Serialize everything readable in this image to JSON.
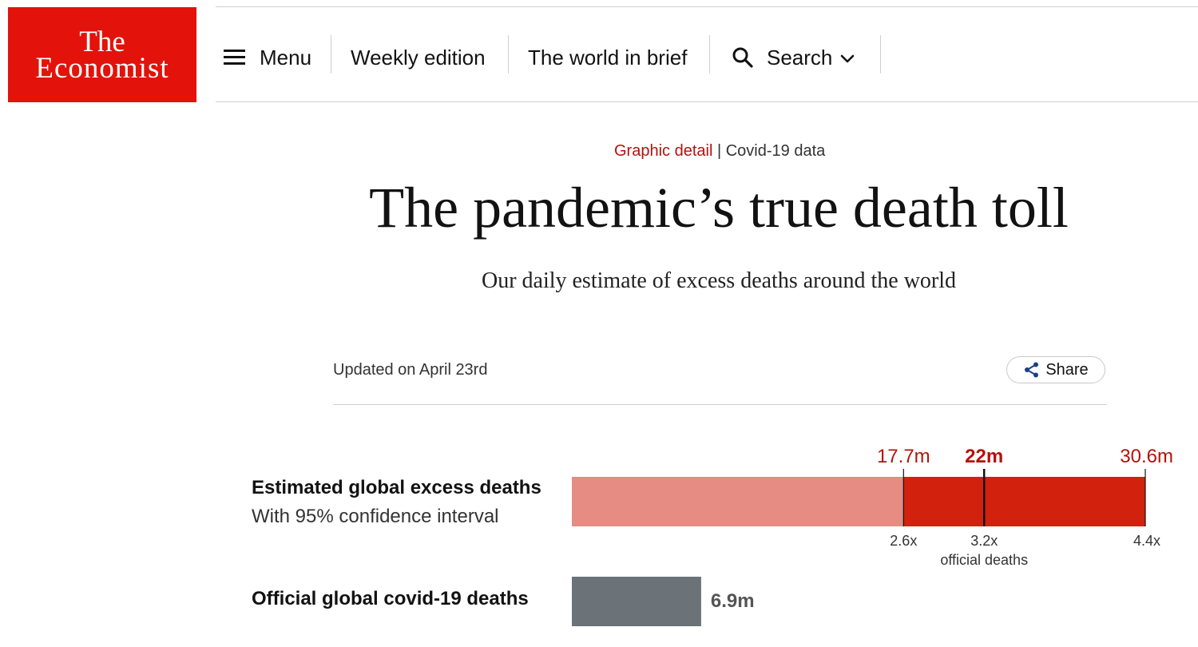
{
  "header": {
    "logo": {
      "line1": "The",
      "line2": "Economist"
    },
    "nav": {
      "menu_label": "Menu",
      "weekly_label": "Weekly edition",
      "world_label": "The world in brief",
      "search_label": "Search"
    }
  },
  "article": {
    "section": "Graphic detail",
    "separator": "|",
    "topic": "Covid-19 data",
    "title": "The pandemic’s true death toll",
    "subtitle": "Our daily estimate of excess deaths around the world",
    "updated": "Updated on April 23rd",
    "share_label": "Share"
  },
  "chart_data": {
    "type": "bar",
    "unit": "m",
    "xlim": [
      0,
      30.6
    ],
    "rows": [
      {
        "label": "Estimated global excess deaths",
        "sublabel": "With 95% confidence interval",
        "central": 22,
        "lower": 17.7,
        "upper": 30.6,
        "top_labels": [
          "17.7m",
          "22m",
          "30.6m"
        ],
        "bottom_labels": [
          "2.6x",
          "3.2x",
          "4.4x"
        ],
        "bottom_caption": "official deaths"
      },
      {
        "label": "Official global covid-19 deaths",
        "value": 6.9,
        "value_label": "6.9m"
      }
    ],
    "colors": {
      "excess_light": "#e68c83",
      "excess_interval": "#d2210d",
      "official": "#6b7378",
      "label_red": "#b5120b"
    }
  }
}
